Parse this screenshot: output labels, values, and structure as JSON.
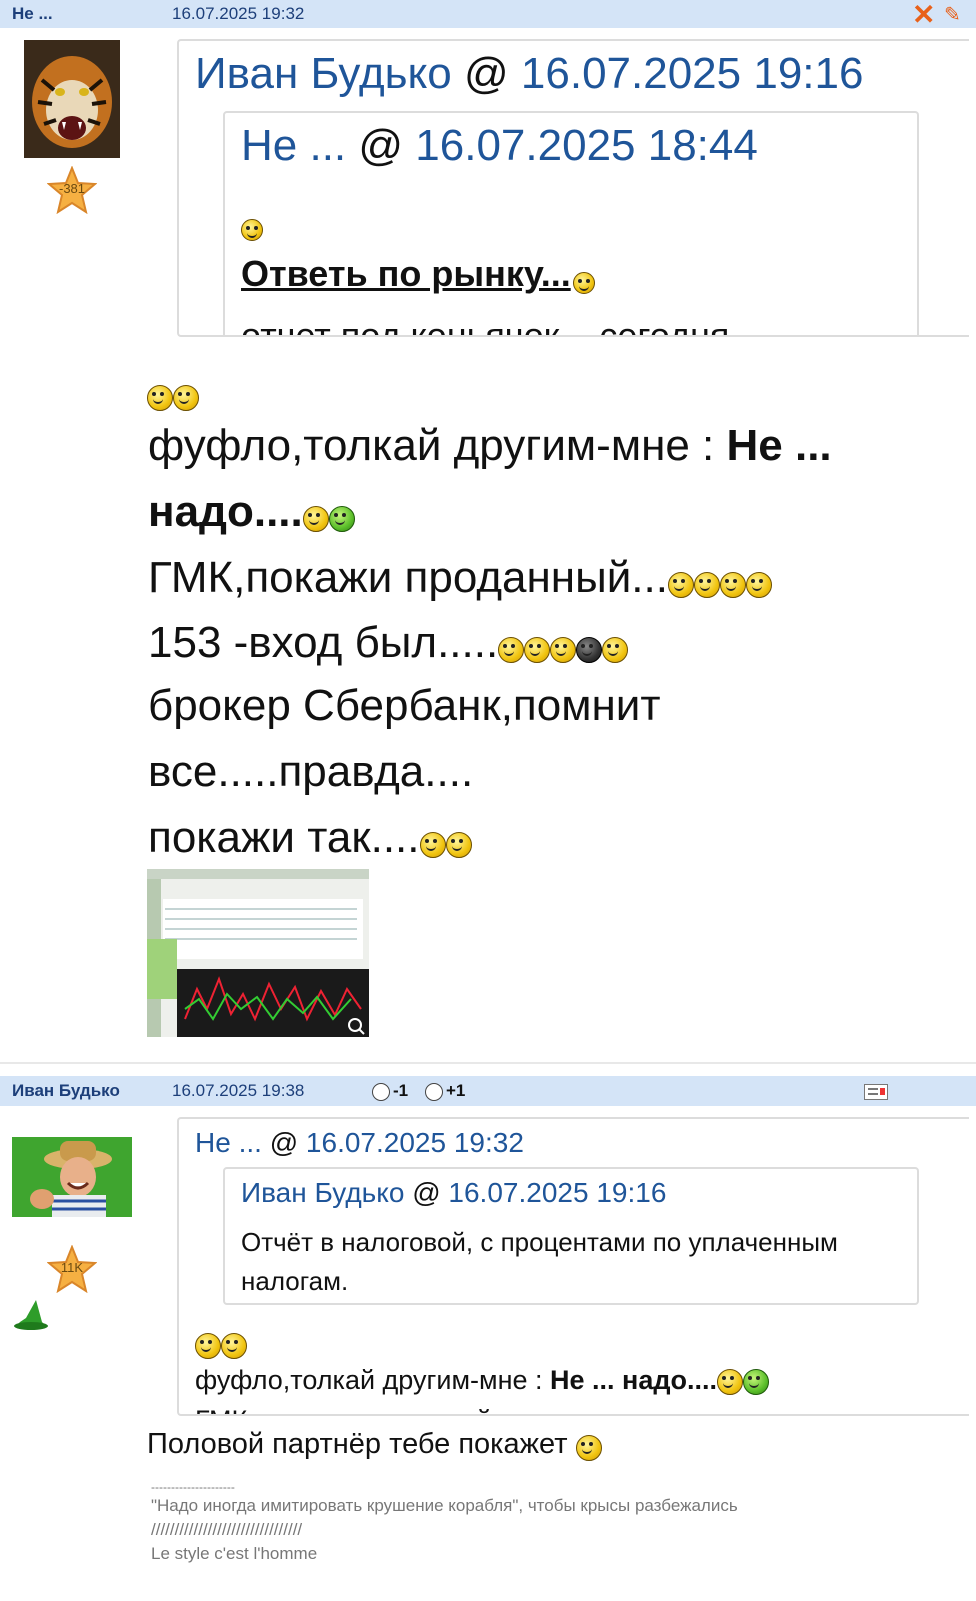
{
  "post1": {
    "author": "Не ...",
    "date": "16.07.2025 19:32",
    "rating": "-381",
    "quote_outer": {
      "author": "Иван Будько",
      "at": "@",
      "date": "16.07.2025 19:16"
    },
    "quote_inner": {
      "author": "Не ...",
      "at": "@",
      "date": "16.07.2025 18:44",
      "heading": "Ответь по рынку...",
      "cut_text": "отчет под коньячок ...сегодня-"
    },
    "lines": [
      {
        "pre": "фуфло,толкай другим-мне : ",
        "bold": "Не ..."
      },
      {
        "bold": "надо...."
      },
      {
        "text": "ГМК,покажи проданный..."
      },
      {
        "text": "153 -вход был....."
      },
      {
        "text": "брокер Сбербанк,помнит"
      },
      {
        "text": "все.....правда...."
      },
      {
        "text": "покажи так...."
      }
    ]
  },
  "post2": {
    "author": "Иван Будько",
    "date": "16.07.2025 19:38",
    "vote_minus": "-1",
    "vote_plus": "+1",
    "rating": "11K",
    "quote_outer": {
      "author": "Не ...",
      "at": "@",
      "date": "16.07.2025 19:32",
      "line_pre": "фуфло,толкай другим-мне : ",
      "line_bold": "Не ... надо....",
      "cut_text": "ГМК,покажи проданный..."
    },
    "quote_inner": {
      "author": "Иван Будько",
      "at": "@",
      "date": "16.07.2025 19:16",
      "text": "Отчёт в налоговой, с процентами по уплаченным налогам."
    },
    "reply": "Половой партнёр тебе покажет",
    "signature": {
      "divider": "---------------------",
      "quote": "\"Надо иногда имитировать крушение корабля\", чтобы крысы разбежались",
      "slashes": "////////////////////////////////",
      "motto": "Le style c'est l'homme"
    }
  }
}
